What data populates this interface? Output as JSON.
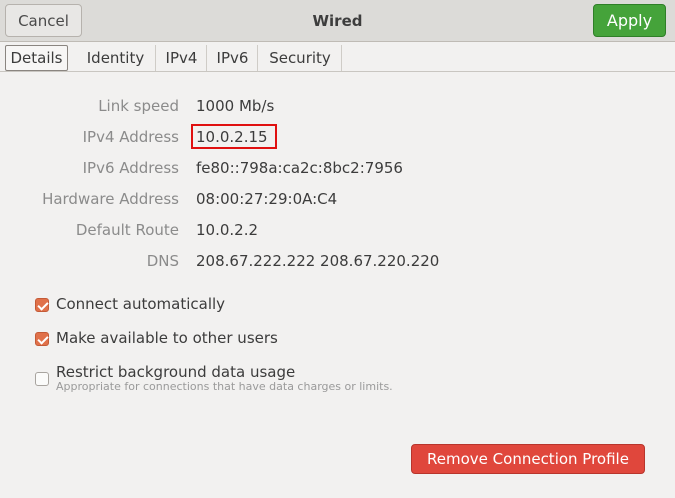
{
  "window": {
    "title": "Wired",
    "cancel_label": "Cancel",
    "apply_label": "Apply"
  },
  "tabs": [
    {
      "label": "Details",
      "active": true
    },
    {
      "label": "Identity",
      "active": false
    },
    {
      "label": "IPv4",
      "active": false
    },
    {
      "label": "IPv6",
      "active": false
    },
    {
      "label": "Security",
      "active": false
    }
  ],
  "details": [
    {
      "label": "Link speed",
      "value": "1000 Mb/s"
    },
    {
      "label": "IPv4 Address",
      "value": "10.0.2.15"
    },
    {
      "label": "IPv6 Address",
      "value": "fe80::798a:ca2c:8bc2:7956"
    },
    {
      "label": "Hardware Address",
      "value": "08:00:27:29:0A:C4"
    },
    {
      "label": "Default Route",
      "value": "10.0.2.2"
    },
    {
      "label": "DNS",
      "value": "208.67.222.222 208.67.220.220"
    }
  ],
  "options": [
    {
      "label": "Connect automatically",
      "checked": true
    },
    {
      "label": "Make available to other users",
      "checked": true
    },
    {
      "label": "Restrict background data usage",
      "checked": false,
      "sublabel": "Appropriate for connections that have data charges or limits."
    }
  ],
  "remove_label": "Remove Connection Profile",
  "colors": {
    "apply": "#45a33a",
    "checkbox_checked": "#e0714a",
    "remove": "#e0473c",
    "highlight_box": "#e01010"
  }
}
